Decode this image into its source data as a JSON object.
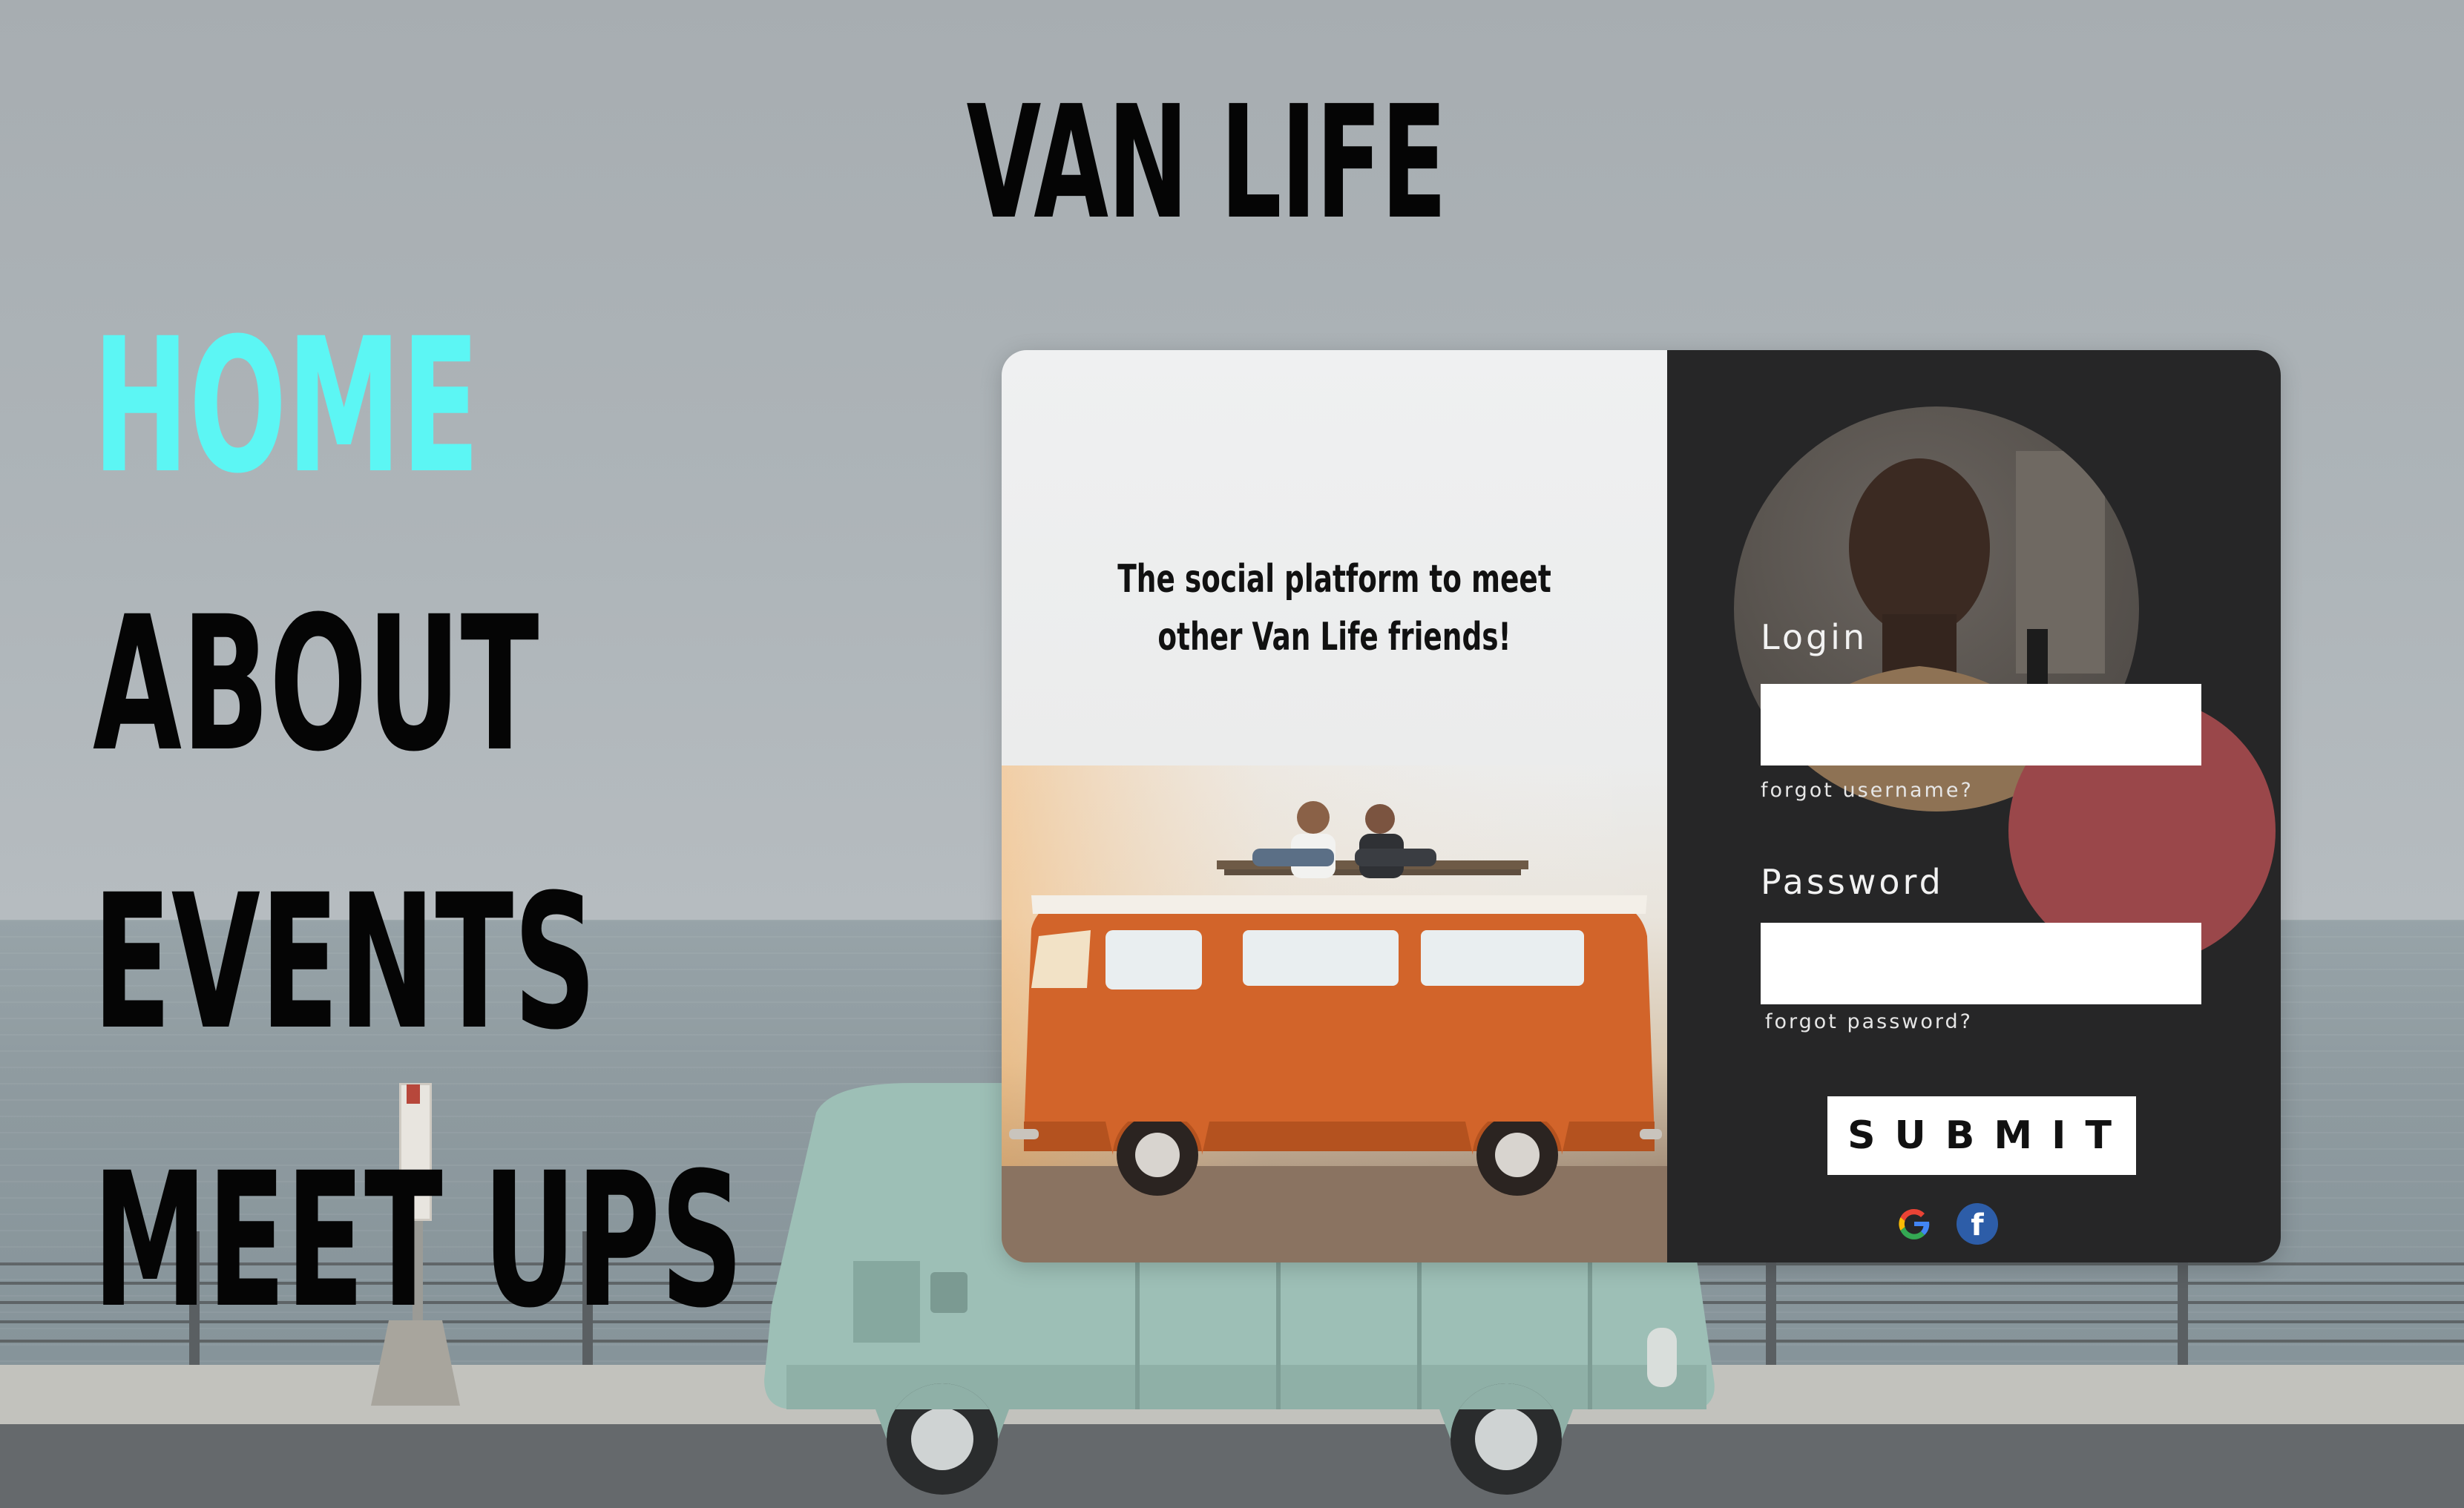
{
  "site": {
    "title": "VAN LIFE"
  },
  "nav": {
    "items": [
      {
        "label": "HOME",
        "active": true
      },
      {
        "label": "ABOUT",
        "active": false
      },
      {
        "label": "EVENTS",
        "active": false
      },
      {
        "label": "MEET UPS",
        "active": false
      }
    ],
    "active_color": "#5cf6f4",
    "text_color": "#050505"
  },
  "card": {
    "tagline_line1": "The social platform to meet",
    "tagline_line2": "other Van Life friends!",
    "login_label": "Login",
    "login_value": "",
    "forgot_username": "forgot username?",
    "password_label": "Password",
    "password_value": "",
    "forgot_password": "forgot password?",
    "submit_label": "SUBMIT",
    "social": {
      "google_icon": "google-icon",
      "facebook_icon": "facebook-icon",
      "facebook_glyph": "f"
    },
    "colors": {
      "panel_dark": "#262627",
      "accent_circle": "#9a474a",
      "van_orange": "#d2642a"
    }
  }
}
